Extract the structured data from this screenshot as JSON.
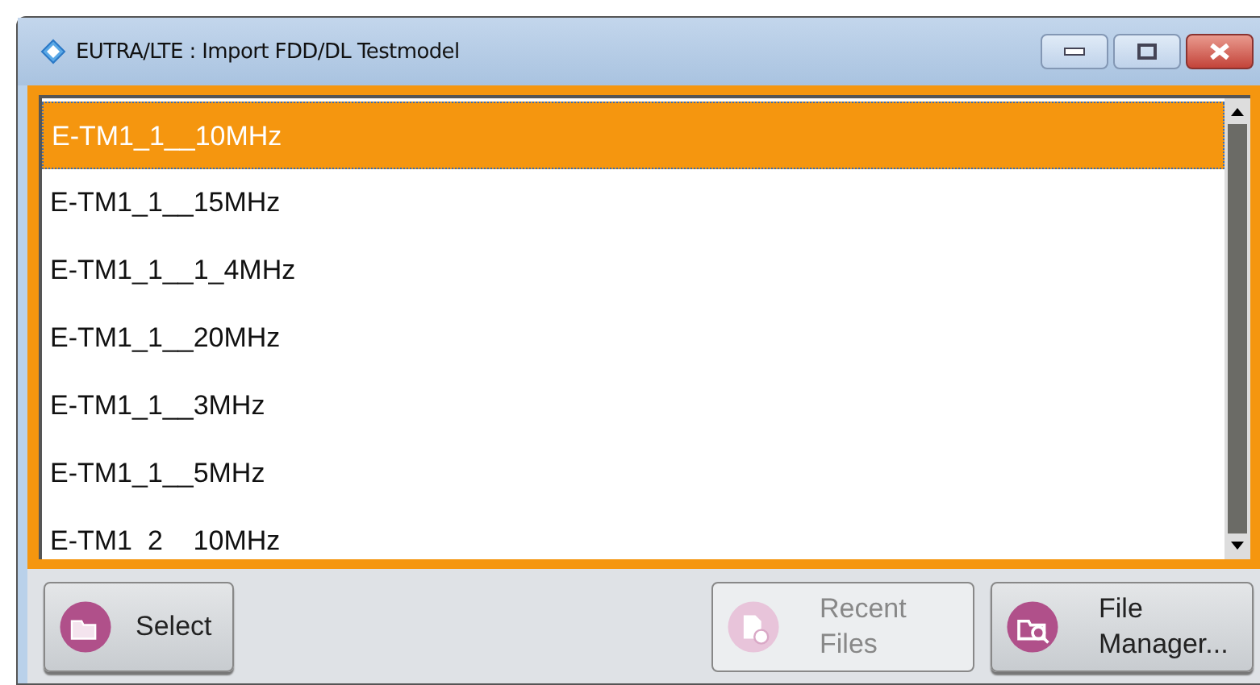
{
  "window": {
    "title": "EUTRA/LTE : Import FDD/DL Testmodel"
  },
  "files": [
    {
      "label": "E-TM1_1__10MHz",
      "selected": true
    },
    {
      "label": "E-TM1_1__15MHz",
      "selected": false
    },
    {
      "label": "E-TM1_1__1_4MHz",
      "selected": false
    },
    {
      "label": "E-TM1_1__20MHz",
      "selected": false
    },
    {
      "label": "E-TM1_1__3MHz",
      "selected": false
    },
    {
      "label": "E-TM1_1__5MHz",
      "selected": false
    },
    {
      "label": "E-TM1  2    10MHz",
      "selected": false
    }
  ],
  "buttons": [
    {
      "label": "Select",
      "kind": "select",
      "disabled": false
    },
    {
      "label": "Recent\nFiles",
      "kind": "recent",
      "disabled": true
    },
    {
      "label": "File\nManager...",
      "kind": "manager",
      "disabled": false
    }
  ]
}
